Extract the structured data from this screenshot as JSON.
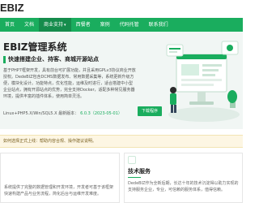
{
  "brand": {
    "logo_text": "EBIZ"
  },
  "nav": {
    "items": [
      {
        "label": "首页",
        "active": false
      },
      {
        "label": "文档",
        "active": false
      },
      {
        "label": "商业支持",
        "active": true,
        "has_caret": true
      },
      {
        "label": "西餐者",
        "active": false
      },
      {
        "label": "案例",
        "active": false
      },
      {
        "label": "代码托管",
        "active": false
      },
      {
        "label": "联系我们",
        "active": false
      }
    ]
  },
  "hero": {
    "title": "EBIZ管理系统",
    "subtitle": "快速搭建企业、持客、商城开源站点",
    "description": "基于PHP7框架开发，具有前台可扩展功能，并且采用GPLv3协议商业开放授权。DedeBIZ包含DCMS数据发布、常用数据采集等，系统更新升级方便，模块化设计。功能特点，优化性能，运维及时进行，适合搭建中小型企业站点，拥有开源站点的优势，完全支持Docker，适配多种常见服务器环境，提供丰富的插件体系，使用简单灵活。",
    "footer_label": "Linux+PHP5.X/Win/SQL5.X 最新版本：",
    "version": "6.0.3（2023-05-01）",
    "download_label": "下载程序"
  },
  "notice": {
    "text": "如何选择正式上线：帮助内容合规、操作建议说明。"
  },
  "cards": {
    "left": {
      "text": "系统提供了完整的数据管理和开发环境，开发者可基于该框架快速构建产品与业务流程，简化后台与运维开发难度。"
    },
    "right": {
      "title": "技术服务",
      "text": "DedeBIZ作为全新后期，长达十年的技术沉淀得以助力实现的支持服务企业，专业，可信赖的服务体系，值得信赖。"
    }
  },
  "colors": {
    "brand_green": "#1aad5e",
    "nav_active": "#158c4c",
    "hero_bg": "#f1f6f4",
    "notice_bg": "#fdf6e3"
  }
}
